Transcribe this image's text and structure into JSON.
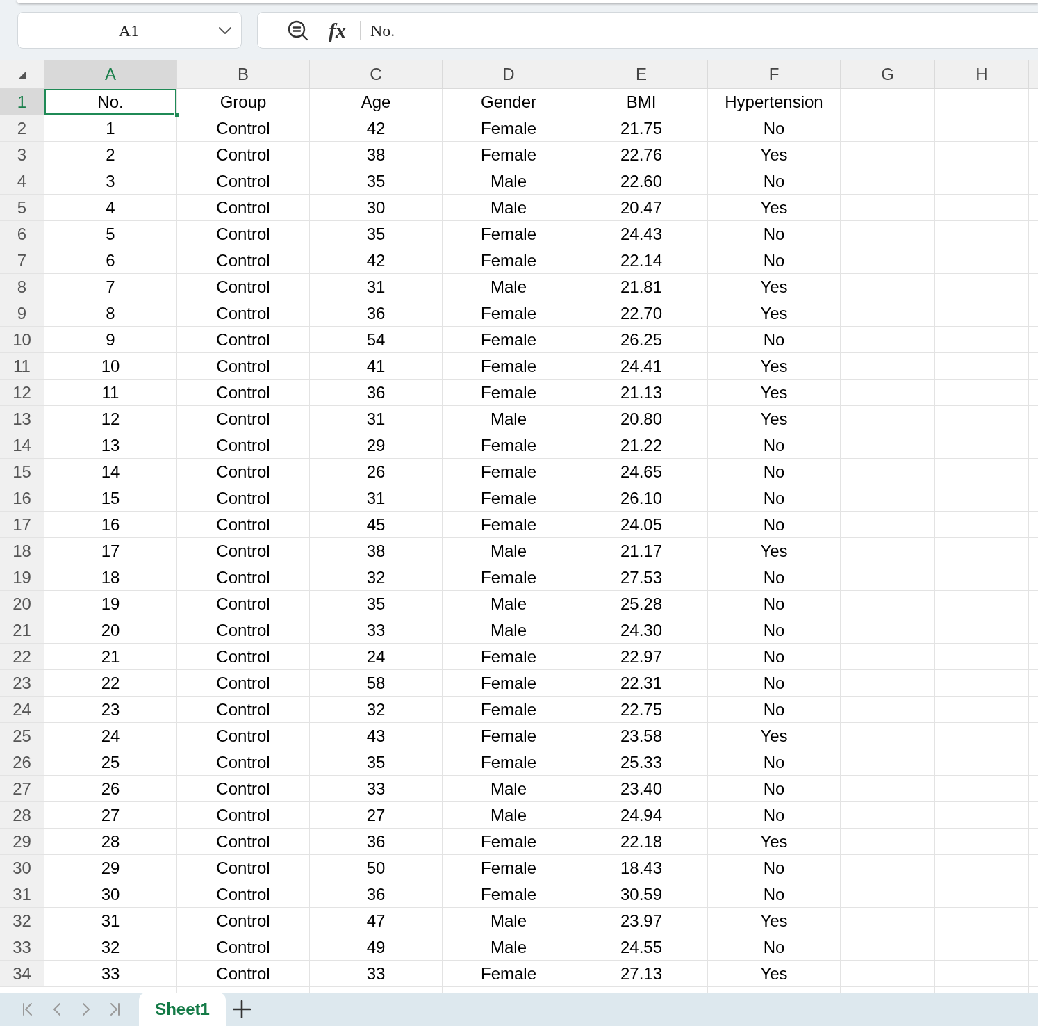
{
  "name_box": {
    "value": "A1"
  },
  "formula_bar": {
    "function_label": "fx",
    "value": "No."
  },
  "grid": {
    "columns": [
      {
        "label": "A",
        "selected": true
      },
      {
        "label": "B",
        "selected": false
      },
      {
        "label": "C",
        "selected": false
      },
      {
        "label": "D",
        "selected": false
      },
      {
        "label": "E",
        "selected": false
      },
      {
        "label": "F",
        "selected": false
      },
      {
        "label": "G",
        "selected": false
      },
      {
        "label": "H",
        "selected": false
      }
    ],
    "rows": [
      {
        "label": "1",
        "selected": true,
        "cells": [
          "No.",
          "Group",
          "Age",
          "Gender",
          "BMI",
          "Hypertension"
        ]
      },
      {
        "label": "2",
        "selected": false,
        "cells": [
          "1",
          "Control",
          "42",
          "Female",
          "21.75",
          "No"
        ]
      },
      {
        "label": "3",
        "selected": false,
        "cells": [
          "2",
          "Control",
          "38",
          "Female",
          "22.76",
          "Yes"
        ]
      },
      {
        "label": "4",
        "selected": false,
        "cells": [
          "3",
          "Control",
          "35",
          "Male",
          "22.60",
          "No"
        ]
      },
      {
        "label": "5",
        "selected": false,
        "cells": [
          "4",
          "Control",
          "30",
          "Male",
          "20.47",
          "Yes"
        ]
      },
      {
        "label": "6",
        "selected": false,
        "cells": [
          "5",
          "Control",
          "35",
          "Female",
          "24.43",
          "No"
        ]
      },
      {
        "label": "7",
        "selected": false,
        "cells": [
          "6",
          "Control",
          "42",
          "Female",
          "22.14",
          "No"
        ]
      },
      {
        "label": "8",
        "selected": false,
        "cells": [
          "7",
          "Control",
          "31",
          "Male",
          "21.81",
          "Yes"
        ]
      },
      {
        "label": "9",
        "selected": false,
        "cells": [
          "8",
          "Control",
          "36",
          "Female",
          "22.70",
          "Yes"
        ]
      },
      {
        "label": "10",
        "selected": false,
        "cells": [
          "9",
          "Control",
          "54",
          "Female",
          "26.25",
          "No"
        ]
      },
      {
        "label": "11",
        "selected": false,
        "cells": [
          "10",
          "Control",
          "41",
          "Female",
          "24.41",
          "Yes"
        ]
      },
      {
        "label": "12",
        "selected": false,
        "cells": [
          "11",
          "Control",
          "36",
          "Female",
          "21.13",
          "Yes"
        ]
      },
      {
        "label": "13",
        "selected": false,
        "cells": [
          "12",
          "Control",
          "31",
          "Male",
          "20.80",
          "Yes"
        ]
      },
      {
        "label": "14",
        "selected": false,
        "cells": [
          "13",
          "Control",
          "29",
          "Female",
          "21.22",
          "No"
        ]
      },
      {
        "label": "15",
        "selected": false,
        "cells": [
          "14",
          "Control",
          "26",
          "Female",
          "24.65",
          "No"
        ]
      },
      {
        "label": "16",
        "selected": false,
        "cells": [
          "15",
          "Control",
          "31",
          "Female",
          "26.10",
          "No"
        ]
      },
      {
        "label": "17",
        "selected": false,
        "cells": [
          "16",
          "Control",
          "45",
          "Female",
          "24.05",
          "No"
        ]
      },
      {
        "label": "18",
        "selected": false,
        "cells": [
          "17",
          "Control",
          "38",
          "Male",
          "21.17",
          "Yes"
        ]
      },
      {
        "label": "19",
        "selected": false,
        "cells": [
          "18",
          "Control",
          "32",
          "Female",
          "27.53",
          "No"
        ]
      },
      {
        "label": "20",
        "selected": false,
        "cells": [
          "19",
          "Control",
          "35",
          "Male",
          "25.28",
          "No"
        ]
      },
      {
        "label": "21",
        "selected": false,
        "cells": [
          "20",
          "Control",
          "33",
          "Male",
          "24.30",
          "No"
        ]
      },
      {
        "label": "22",
        "selected": false,
        "cells": [
          "21",
          "Control",
          "24",
          "Female",
          "22.97",
          "No"
        ]
      },
      {
        "label": "23",
        "selected": false,
        "cells": [
          "22",
          "Control",
          "58",
          "Female",
          "22.31",
          "No"
        ]
      },
      {
        "label": "24",
        "selected": false,
        "cells": [
          "23",
          "Control",
          "32",
          "Female",
          "22.75",
          "No"
        ]
      },
      {
        "label": "25",
        "selected": false,
        "cells": [
          "24",
          "Control",
          "43",
          "Female",
          "23.58",
          "Yes"
        ]
      },
      {
        "label": "26",
        "selected": false,
        "cells": [
          "25",
          "Control",
          "35",
          "Female",
          "25.33",
          "No"
        ]
      },
      {
        "label": "27",
        "selected": false,
        "cells": [
          "26",
          "Control",
          "33",
          "Male",
          "23.40",
          "No"
        ]
      },
      {
        "label": "28",
        "selected": false,
        "cells": [
          "27",
          "Control",
          "27",
          "Male",
          "24.94",
          "No"
        ]
      },
      {
        "label": "29",
        "selected": false,
        "cells": [
          "28",
          "Control",
          "36",
          "Female",
          "22.18",
          "Yes"
        ]
      },
      {
        "label": "30",
        "selected": false,
        "cells": [
          "29",
          "Control",
          "50",
          "Female",
          "18.43",
          "No"
        ]
      },
      {
        "label": "31",
        "selected": false,
        "cells": [
          "30",
          "Control",
          "36",
          "Female",
          "30.59",
          "No"
        ]
      },
      {
        "label": "32",
        "selected": false,
        "cells": [
          "31",
          "Control",
          "47",
          "Male",
          "23.97",
          "Yes"
        ]
      },
      {
        "label": "33",
        "selected": false,
        "cells": [
          "32",
          "Control",
          "49",
          "Male",
          "24.55",
          "No"
        ]
      },
      {
        "label": "34",
        "selected": false,
        "cells": [
          "33",
          "Control",
          "33",
          "Female",
          "27.13",
          "Yes"
        ]
      }
    ]
  },
  "sheet_tabs": [
    {
      "label": "Sheet1",
      "selected": true
    }
  ]
}
